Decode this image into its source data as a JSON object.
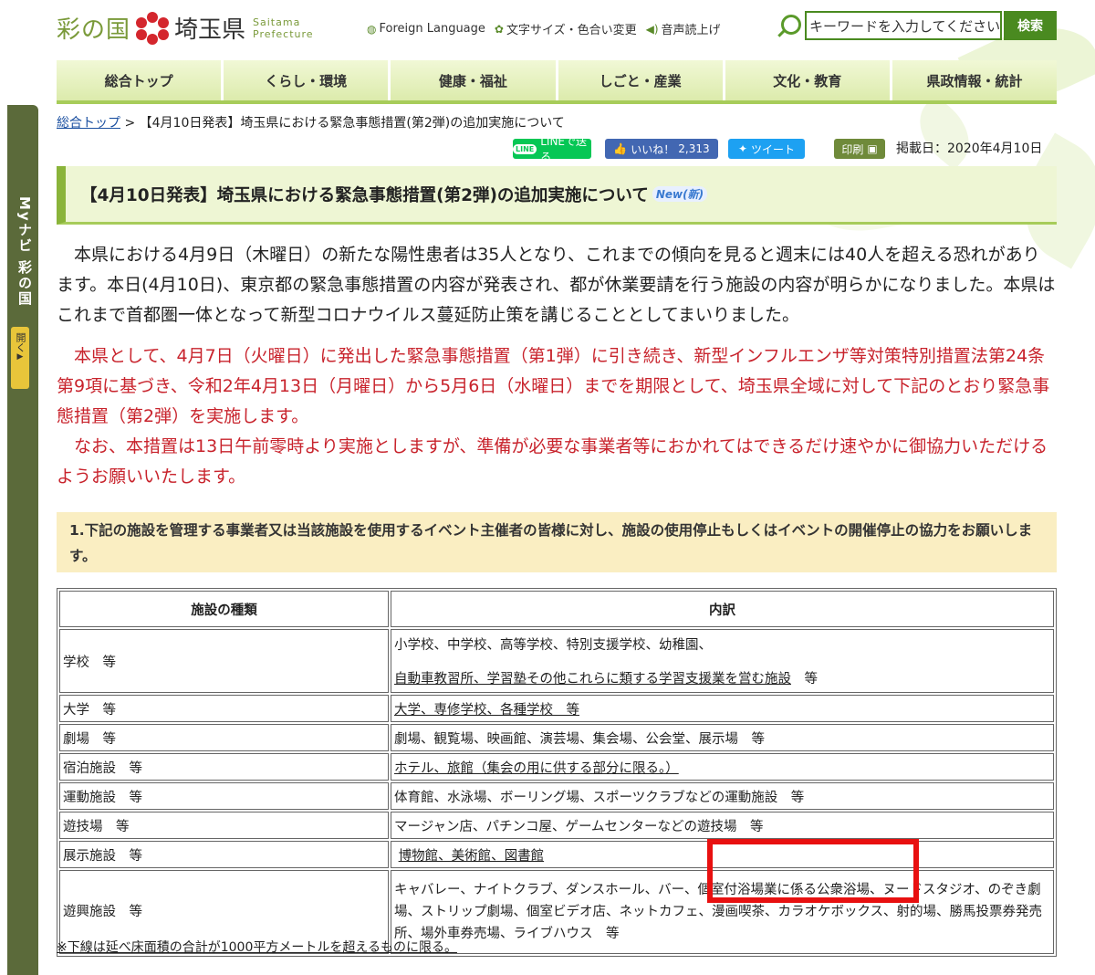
{
  "header": {
    "logo_sai": "彩の国",
    "logo_ken": "埼玉県",
    "logo_en_1": "Saitama",
    "logo_en_2": "Prefecture",
    "util": [
      "Foreign Language",
      "文字サイズ・色合い変更",
      "音声読上げ"
    ],
    "search_placeholder": "キーワードを入力してください",
    "search_button": "検索"
  },
  "nav": [
    "総合トップ",
    "くらし・環境",
    "健康・福祉",
    "しごと・産業",
    "文化・教育",
    "県政情報・統計"
  ],
  "sidetab": {
    "label": "Myナビ 彩の国",
    "open": "開く"
  },
  "breadcrumb": {
    "home": "総合トップ",
    "sep": ">",
    "current": "【4月10日発表】埼玉県における緊急事態措置(第2弾)の追加実施について"
  },
  "share": {
    "line": "LINEで送る",
    "line_logo": "LINE",
    "like": "いいね！",
    "like_count": "2,313",
    "tweet": "ツイート",
    "print": "印刷"
  },
  "published": "掲載日：2020年4月10日",
  "title": "【4月10日発表】埼玉県における緊急事態措置(第2弾)の追加実施について",
  "new_badge": "New(新)",
  "paragraph1": "本県における4月9日（木曜日）の新たな陽性患者は35人となり、これまでの傾向を見ると週末には40人を超える恐れがあります。本日(4月10日)、東京都の緊急事態措置の内容が発表され、都が休業要請を行う施設の内容が明らかになりました。本県はこれまで首都圏一体となって新型コロナウイルス蔓延防止策を講じることとしてまいりました。",
  "paragraph2a": "本県として、4月7日（火曜日）に発出した緊急事態措置（第1弾）に引き続き、新型インフルエンザ等対策特別措置法第24条第9項に基づき、令和2年4月13日（月曜日）から5月6日（水曜日）までを期限として、埼玉県全域に対して下記のとおり緊急事態措置（第2弾）を実施します。",
  "paragraph2b": "なお、本措置は13日午前零時より実施としますが、準備が必要な事業者等におかれてはできるだけ速やかに御協力いただけるようお願いいたします。",
  "section_heading": "1.下記の施設を管理する事業者又は当該施設を使用するイベント主催者の皆様に対し、施設の使用停止もしくはイベントの開催停止の協力をお願いします。",
  "table": {
    "headers": [
      "施設の種類",
      "内訳"
    ],
    "rows": [
      {
        "type": "学校　等",
        "detail1": "小学校、中学校、高等学校、特別支援学校、幼稚園、",
        "detail2": "自動車教習所、学習塾その他これらに類する学習支援業を営む施設",
        "detail2_suffix": "　等"
      },
      {
        "type": "大学　等",
        "detail": "大学、専修学校、各種学校　等"
      },
      {
        "type": "劇場　等",
        "detail": "劇場、観覧場、映画館、演芸場、集会場、公会堂、展示場　等"
      },
      {
        "type": "宿泊施設　等",
        "detail": "ホテル、旅館（集会の用に供する部分に限る。）"
      },
      {
        "type": "運動施設　等",
        "detail": "体育館、水泳場、ボーリング場、スポーツクラブなどの運動施設　等"
      },
      {
        "type": "遊技場　等",
        "detail": "マージャン店、パチンコ屋、ゲームセンターなどの遊技場　等"
      },
      {
        "type": "展示施設　等",
        "detail": "博物館、美術館、図書館"
      },
      {
        "type": "遊興施設　等",
        "detail": "キャバレー、ナイトクラブ、ダンスホール、バー、個室付浴場業に係る公衆浴場、ヌードスタジオ、のぞき劇場、ストリップ劇場、個室ビデオ店、ネットカフェ、漫画喫茶、カラオケボックス、射的場、勝馬投票券発売所、場外車券売場、ライブハウス　等"
      }
    ]
  },
  "footnote": "※下線は延べ床面積の合計が1000平方メートルを超えるものに限る。",
  "colors": {
    "nav_bg": "#e7f2c0",
    "accent_green": "#4a8a20",
    "notice_red": "#c8232c",
    "highlight_red": "#e81010"
  }
}
